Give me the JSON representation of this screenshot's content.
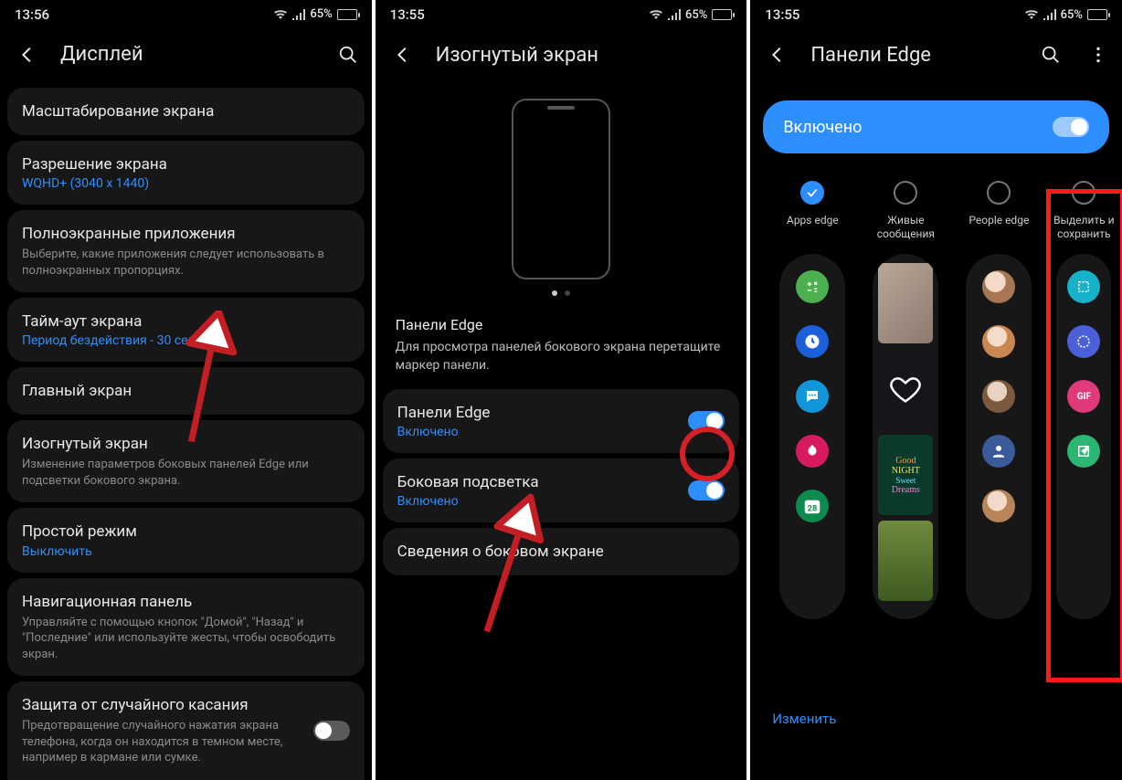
{
  "status": {
    "t1": "13:56",
    "t2": "13:55",
    "t3": "13:55",
    "battery": "65%"
  },
  "screen1": {
    "title": "Дисплей",
    "items": {
      "zoom": "Масштабирование экрана",
      "res": {
        "t": "Разрешение экрана",
        "v": "WQHD+ (3040 x 1440)"
      },
      "full": {
        "t": "Полноэкранные приложения",
        "d": "Выберите, какие приложения следует использовать в полноэкранных пропорциях."
      },
      "timeout": {
        "t": "Тайм-аут экрана",
        "v": "Период бездействия - 30 секунд"
      },
      "home": "Главный экран",
      "edge": {
        "t": "Изогнутый экран",
        "d": "Изменение параметров боковых панелей Edge или подсветки бокового экрана."
      },
      "easy": {
        "t": "Простой режим",
        "v": "Выключить"
      },
      "nav": {
        "t": "Навигационная панель",
        "d": "Управляйте с помощью кнопок \"Домой\", \"Назад\" и \"Последние\" или используйте жесты, чтобы освободить экран."
      },
      "accident": {
        "t": "Защита от случайного касания",
        "d": "Предотвращение случайного нажатия экрана телефона, когда он находится в темном месте, например в кармане или сумке."
      }
    }
  },
  "screen2": {
    "title": "Изогнутый экран",
    "desc": {
      "t": "Панели Edge",
      "d": "Для просмотра панелей бокового экрана перетащите маркер панели."
    },
    "panels": {
      "t": "Панели Edge",
      "v": "Включено"
    },
    "light": {
      "t": "Боковая подсветка",
      "v": "Включено"
    },
    "info": "Сведения о боковом экране"
  },
  "screen3": {
    "title": "Панели Edge",
    "enabled": "Включено",
    "cols": [
      "Apps edge",
      "Живые сообщения",
      "People edge",
      "Выделить и сохранить"
    ],
    "calendar_day": "28",
    "gif_label": "GIF",
    "goodnight": [
      "Good",
      "NIGHT",
      "Sweet",
      "Dreams"
    ],
    "edit": "Изменить"
  }
}
